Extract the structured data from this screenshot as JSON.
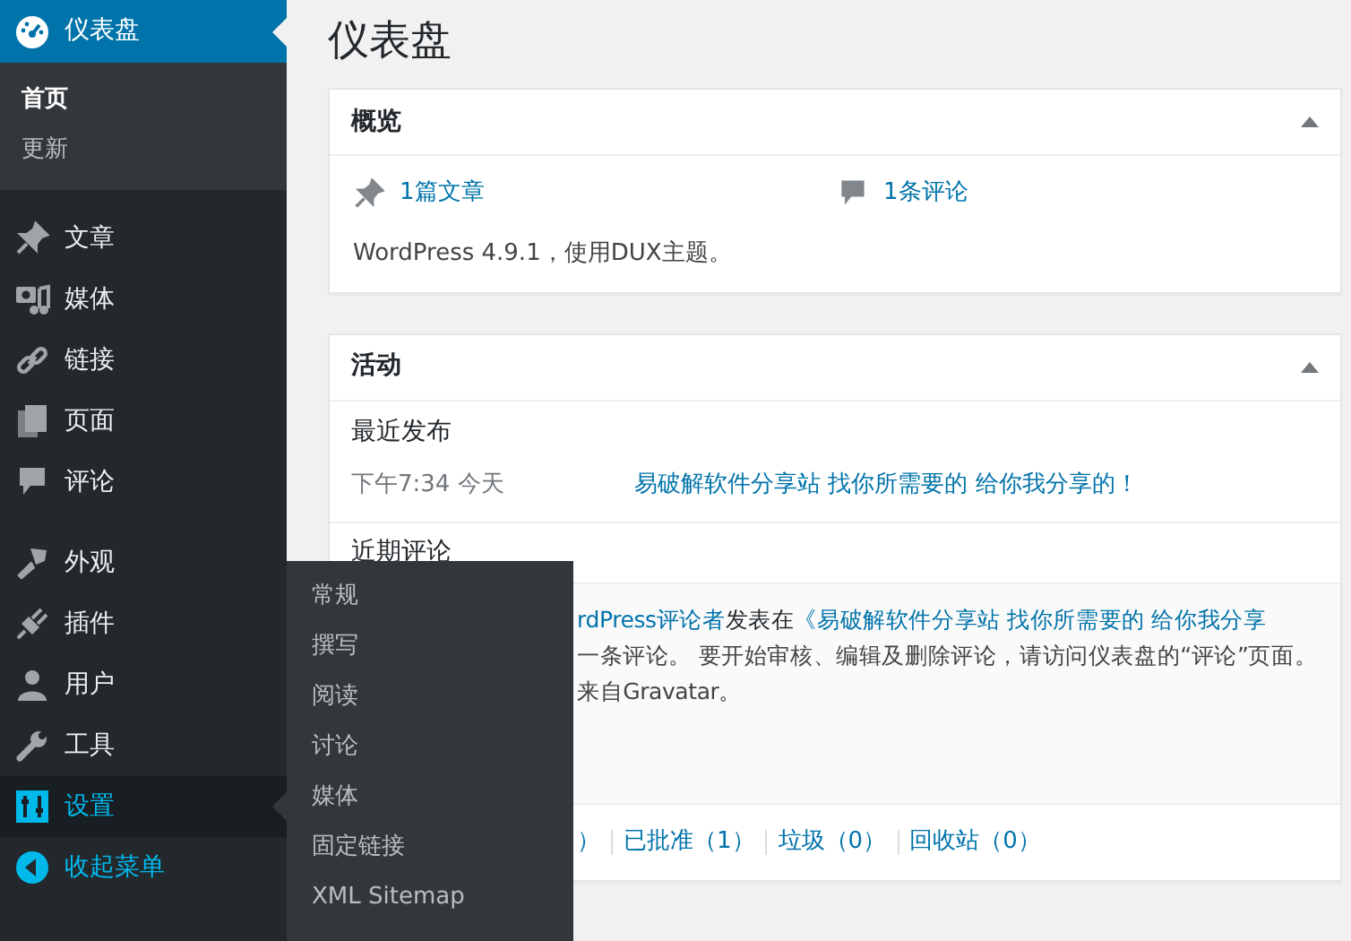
{
  "sidebar": {
    "groups": [
      [
        {
          "label": "仪表盘",
          "selected": true,
          "open": false,
          "submenu": [
            {
              "label": "首页",
              "selected": true
            },
            {
              "label": "更新",
              "selected": false
            }
          ]
        }
      ],
      [
        {
          "label": "文章",
          "selected": false,
          "open": false
        },
        {
          "label": "媒体",
          "selected": false,
          "open": false
        },
        {
          "label": "链接",
          "selected": false,
          "open": false
        },
        {
          "label": "页面",
          "selected": false,
          "open": false
        },
        {
          "label": "评论",
          "selected": false,
          "open": false
        }
      ],
      [
        {
          "label": "外观",
          "selected": false,
          "open": false
        },
        {
          "label": "插件",
          "selected": false,
          "open": false
        },
        {
          "label": "用户",
          "selected": false,
          "open": false
        },
        {
          "label": "工具",
          "selected": false,
          "open": false
        },
        {
          "label": "设置",
          "selected": false,
          "open": true,
          "flyout": [
            "常规",
            "撰写",
            "阅读",
            "讨论",
            "媒体",
            "固定链接",
            "XML Sitemap"
          ]
        }
      ]
    ],
    "collapse": {
      "label": "收起菜单"
    }
  },
  "page_title": "仪表盘",
  "overview": {
    "title": "概览",
    "expanded": true,
    "stats": [
      "1篇文章",
      "1条评论"
    ],
    "footer": "WordPress 4.9.1，使用DUX主题。"
  },
  "activity": {
    "title": "活动",
    "expanded": true,
    "recent_posts": {
      "heading": "最近发布",
      "items": [
        {
          "time": "下午7:34 今天",
          "title": "易破解软件分享站 找你所需要的 给你我分享的！"
        }
      ]
    },
    "recent_comments": {
      "heading": "近期评论",
      "comment_parts": [
        {
          "kind": "link",
          "text": "rdPress评论者"
        },
        {
          "kind": "text",
          "text": "发表在"
        },
        {
          "kind": "link",
          "text": "《易破解软件分享站 找你所需要的 给你我分享"
        }
      ],
      "lines": [
        "一条评论。 要开始审核、编辑及删除评论，请访问仪表盘的“评论”页面。",
        "来自Gravatar。"
      ]
    },
    "filters": [
      "）",
      "已批准（1）",
      "垃圾（0）",
      "回收站（0）"
    ]
  }
}
